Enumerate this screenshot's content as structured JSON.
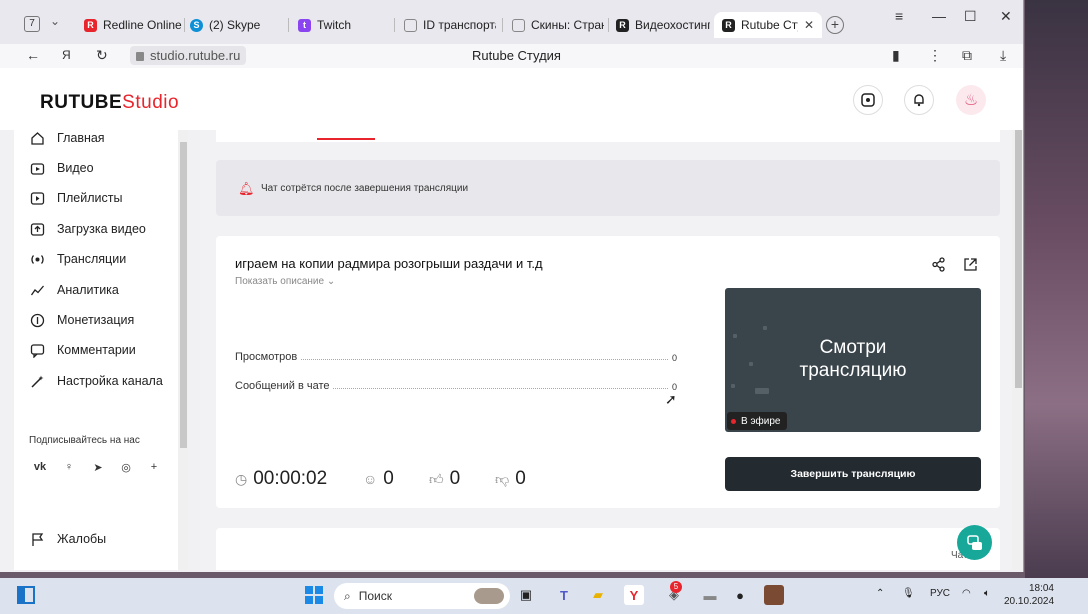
{
  "browser": {
    "tab_count": "7",
    "tabs": [
      {
        "label": "Redline Online",
        "fav_color": "#e8252d",
        "icon": "redline-icon"
      },
      {
        "label": "(2) Skype",
        "fav_color": "#0e8fd6",
        "icon": "skype-icon"
      },
      {
        "label": "Twitch",
        "fav_color": "#8a45f0",
        "icon": "twitch-icon"
      },
      {
        "label": "ID транспорта",
        "fav_color": "#888888",
        "icon": "document-icon"
      },
      {
        "label": "Скины: Стран",
        "fav_color": "#888888",
        "icon": "document-icon"
      },
      {
        "label": "Видеохостинг",
        "fav_color": "#222222",
        "icon": "rutube-icon"
      },
      {
        "label": "Rutube Студ",
        "fav_color": "#222222",
        "icon": "rutube-icon"
      }
    ],
    "url": "studio.rutube.ru",
    "page_title": "Rutube Студия"
  },
  "app": {
    "logo_main": "RUTUBE",
    "logo_studio": "Studio"
  },
  "sidebar": {
    "items": [
      {
        "label": "Главная",
        "icon": "home-icon"
      },
      {
        "label": "Видео",
        "icon": "video-icon"
      },
      {
        "label": "Плейлисты",
        "icon": "playlist-icon"
      },
      {
        "label": "Загрузка видео",
        "icon": "upload-icon"
      },
      {
        "label": "Трансляции",
        "icon": "broadcast-icon"
      },
      {
        "label": "Аналитика",
        "icon": "analytics-icon"
      },
      {
        "label": "Монетизация",
        "icon": "money-icon"
      },
      {
        "label": "Комментарии",
        "icon": "comments-icon"
      },
      {
        "label": "Настройка канала",
        "icon": "wand-icon"
      }
    ],
    "subscribe_label": "Подписывайтесь на нас",
    "complaints_label": "Жалобы"
  },
  "main": {
    "notice_text": "Чат сотрётся после завершения трансляции",
    "stream_title": "играем на копии радмира розогрыши раздачи и т.д",
    "show_description": "Показать описание",
    "stats": [
      {
        "label": "Просмотров",
        "value": "0"
      },
      {
        "label": "Сообщений в чате",
        "value": "0"
      }
    ],
    "preview_text_line1": "Смотри",
    "preview_text_line2": "трансляцию",
    "live_badge": "В эфире",
    "timer": "00:00:02",
    "viewers": "0",
    "likes": "0",
    "dislikes": "0",
    "end_button": "Завершить трансляцию",
    "chat_label": "Чат"
  },
  "taskbar": {
    "search_placeholder": "Поиск",
    "lang": "РУС",
    "time": "18:04",
    "date": "20.10.2024",
    "badge": "5"
  },
  "colors": {
    "accent": "#e8252d",
    "dark_button": "#232a30",
    "fab": "#17a89a"
  }
}
